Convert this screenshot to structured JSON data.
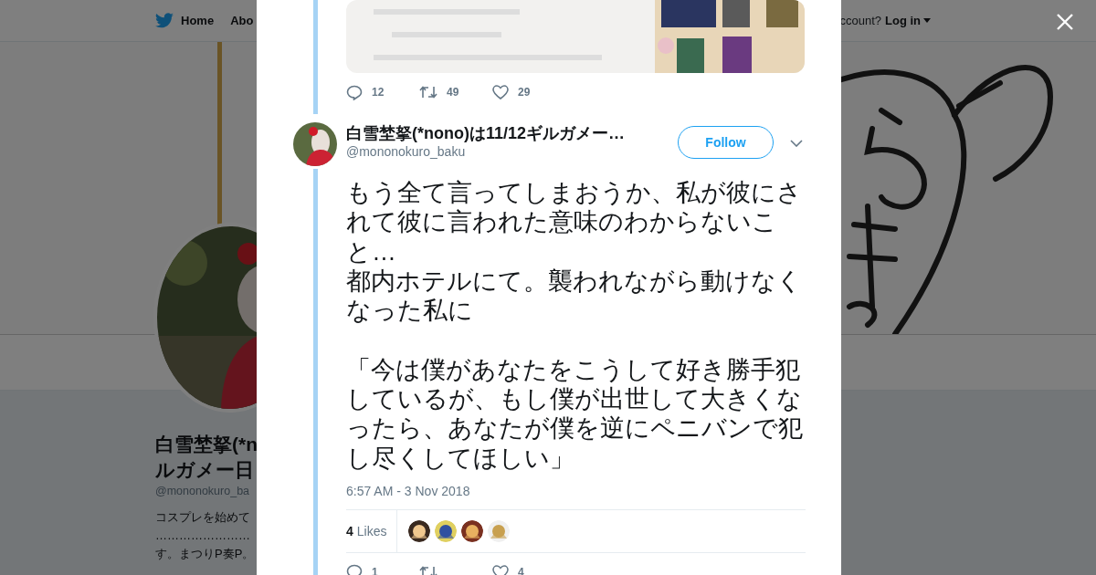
{
  "background_page": {
    "nav": {
      "items": [
        "Home",
        "Abo"
      ],
      "login_prompt": "ccount?",
      "login": "Log in"
    },
    "profile": {
      "name_lines": [
        "白雪埜拏(*n",
        "ルガメー日"
      ],
      "handle": "@mononokuro_ba",
      "bio_lines": [
        "コスプレを始めて",
        "……………………",
        "す。まつりP奏P。"
      ]
    }
  },
  "previous_tweet": {
    "actions": [
      {
        "kind": "reply",
        "count": "12"
      },
      {
        "kind": "retweet",
        "count": "49"
      },
      {
        "kind": "like",
        "count": "29"
      }
    ]
  },
  "tweet": {
    "author": {
      "name": "白雪埜拏(*nono)は11/12ギルガメー…",
      "handle": "@mononokuro_baku"
    },
    "follow_label": "Follow",
    "paragraphs": [
      [
        "もう全て言ってしまおうか、私が彼にされて彼に言われた意味のわからないこと…",
        "都内ホテルにて。襲われながら動けなくなった私に"
      ],
      [
        "「今は僕があなたをこうして好き勝手犯しているが、もし僕が出世して大きくなったら、あなたが僕を逆にペニバンで犯し尽くしてほしい」"
      ]
    ],
    "timestamp": "6:57 AM - 3 Nov 2018",
    "likes": {
      "count": "4",
      "label": "Likes"
    },
    "actions": [
      {
        "kind": "reply",
        "count": "1"
      },
      {
        "kind": "retweet"
      },
      {
        "kind": "like",
        "count": "4"
      }
    ]
  }
}
